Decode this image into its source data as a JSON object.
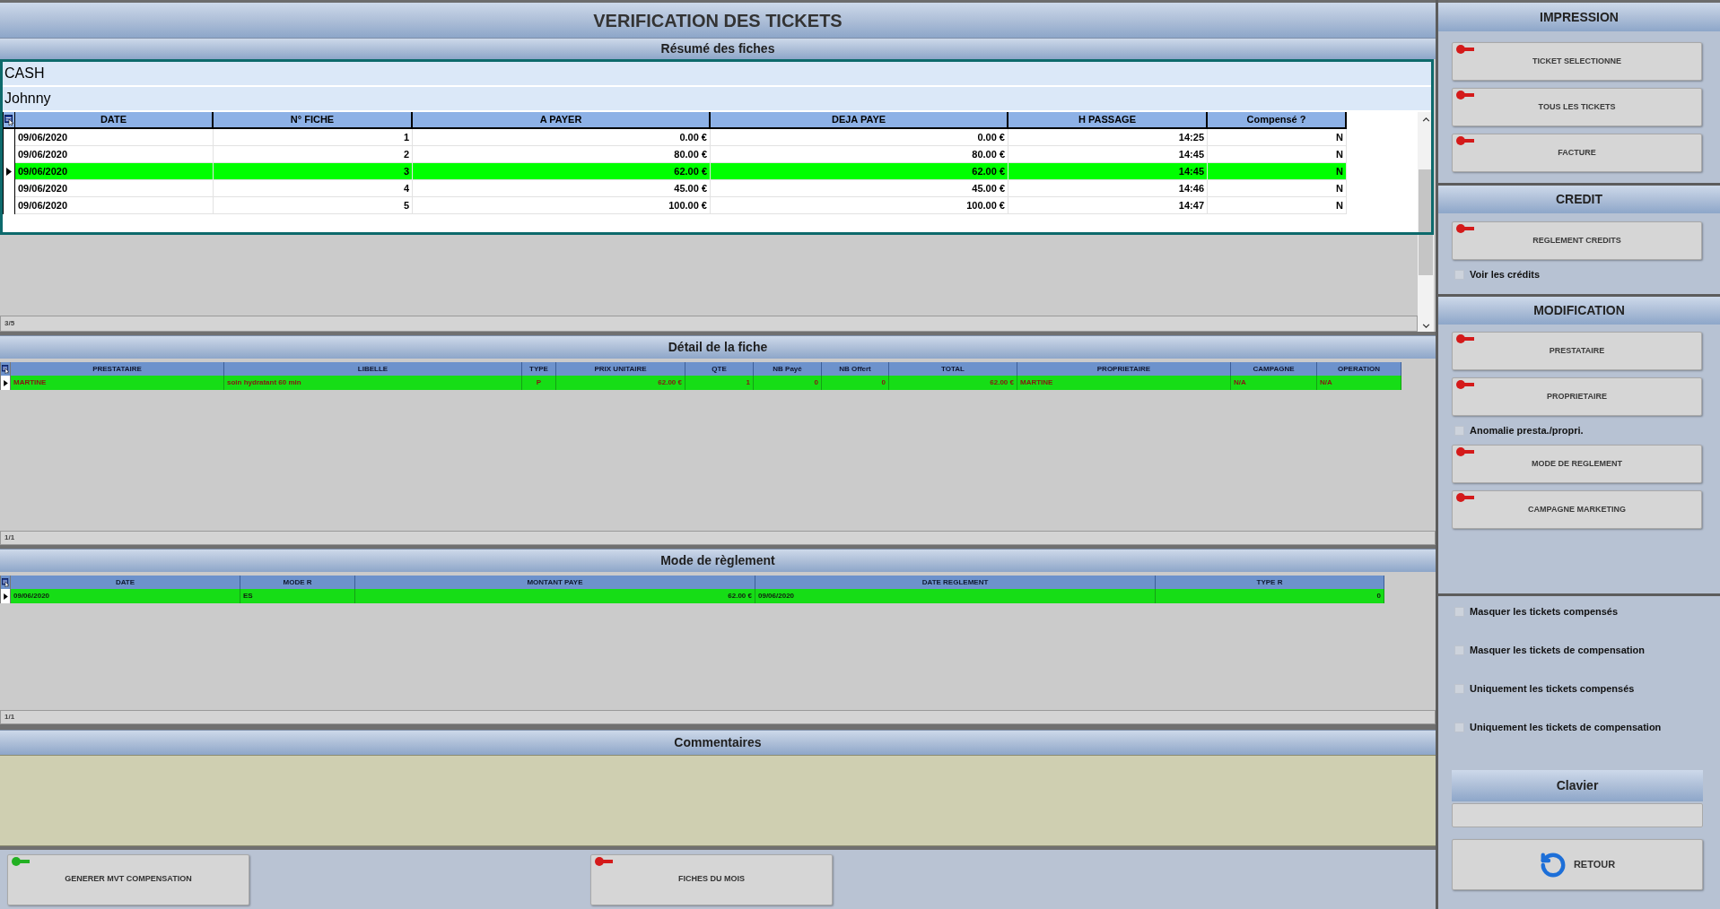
{
  "window": {
    "title": "VERIFICATION DES TICKETS"
  },
  "summary": {
    "title": "Résumé des fiches",
    "account": "CASH",
    "client": "Johnny",
    "table": {
      "columns": [
        "DATE",
        "N° FICHE",
        "A PAYER",
        "DEJA PAYE",
        "H PASSAGE",
        "Compensé ?"
      ],
      "rows": [
        {
          "selected": false,
          "cells": [
            "09/06/2020",
            "1",
            "0.00 €",
            "0.00 €",
            "14:25",
            "N"
          ]
        },
        {
          "selected": false,
          "cells": [
            "09/06/2020",
            "2",
            "80.00 €",
            "80.00 €",
            "14:45",
            "N"
          ]
        },
        {
          "selected": true,
          "cells": [
            "09/06/2020",
            "3",
            "62.00 €",
            "62.00 €",
            "14:45",
            "N"
          ]
        },
        {
          "selected": false,
          "cells": [
            "09/06/2020",
            "4",
            "45.00 €",
            "45.00 €",
            "14:46",
            "N"
          ]
        },
        {
          "selected": false,
          "cells": [
            "09/06/2020",
            "5",
            "100.00 €",
            "100.00 €",
            "14:47",
            "N"
          ]
        }
      ]
    },
    "record_count": "3/5"
  },
  "detail": {
    "title": "Détail de la fiche",
    "table": {
      "columns": [
        "PRESTATAIRE",
        "LIBELLE",
        "TYPE",
        "PRIX UNITAIRE",
        "QTE",
        "NB Payé",
        "NB Offert",
        "TOTAL",
        "PROPRIETAIRE",
        "CAMPAGNE",
        "OPERATION"
      ],
      "rows": [
        {
          "selected": true,
          "cells": [
            "MARTINE",
            "soin hydratant 60 min",
            "P",
            "62.00 €",
            "1",
            "0",
            "0",
            "62.00 €",
            "MARTINE",
            "N/A",
            "N/A"
          ]
        }
      ]
    },
    "record_count": "1/1"
  },
  "payment": {
    "title": "Mode de règlement",
    "table": {
      "columns": [
        "DATE",
        "MODE R",
        "MONTANT PAYE",
        "DATE REGLEMENT",
        "TYPE R"
      ],
      "rows": [
        {
          "selected": true,
          "cells": [
            "09/06/2020",
            "ES",
            "62.00 €",
            "09/06/2020",
            "0"
          ]
        }
      ]
    },
    "record_count": "1/1"
  },
  "comments": {
    "title": "Commentaires"
  },
  "bottom_buttons": [
    {
      "label": "GENERER MVT COMPENSATION",
      "color": "#22b022"
    },
    {
      "label": "FICHES DU MOIS",
      "color": "#d41a1a"
    }
  ],
  "sidebar": {
    "impression": {
      "title": "IMPRESSION",
      "buttons": [
        "TICKET SELECTIONNE",
        "TOUS LES TICKETS",
        "FACTURE"
      ]
    },
    "credit": {
      "title": "CREDIT",
      "items": [
        {
          "kind": "button",
          "label": "REGLEMENT CREDITS"
        },
        {
          "kind": "checkbox",
          "label": "Voir les crédits",
          "checked": false
        }
      ]
    },
    "modification": {
      "title": "MODIFICATION",
      "items": [
        {
          "kind": "button",
          "label": "PRESTATAIRE"
        },
        {
          "kind": "button",
          "label": "PROPRIETAIRE"
        },
        {
          "kind": "checkbox",
          "label": "Anomalie presta./propri.",
          "checked": false
        },
        {
          "kind": "button",
          "label": "MODE DE REGLEMENT"
        },
        {
          "kind": "button",
          "label": "CAMPAGNE MARKETING"
        }
      ]
    },
    "filters": [
      {
        "label": "Masquer les tickets compensés",
        "checked": false
      },
      {
        "label": "Masquer les tickets de compensation",
        "checked": false
      },
      {
        "label": "Uniquement les tickets compensés",
        "checked": false
      },
      {
        "label": "Uniquement les tickets de compensation",
        "checked": false
      }
    ],
    "keyboard": {
      "title": "Clavier"
    },
    "back_button": {
      "label": "RETOUR"
    }
  }
}
